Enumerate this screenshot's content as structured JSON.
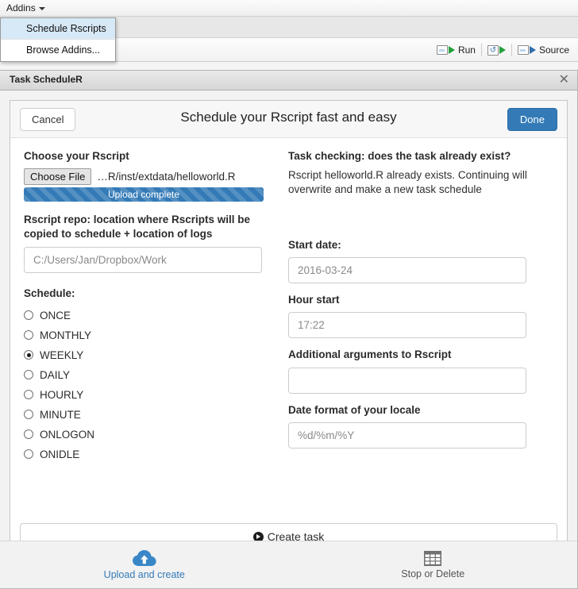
{
  "ide": {
    "menu_label": "Addins",
    "toolbar": [
      {
        "label": "Run",
        "icon": "run-icon"
      },
      {
        "label": "",
        "icon": "rerun-icon"
      },
      {
        "label": "Source",
        "icon": "source-icon"
      }
    ],
    "addins_menu": {
      "items": [
        {
          "label": "Schedule Rscripts",
          "active": true
        },
        {
          "label": "Browse Addins...",
          "active": false
        }
      ]
    }
  },
  "gadget": {
    "window_title": "Task ScheduleR",
    "close_icon": "close-icon",
    "header": {
      "cancel_label": "Cancel",
      "title": "Schedule your Rscript fast and easy",
      "done_label": "Done"
    },
    "left": {
      "choose_label": "Choose your Rscript",
      "file_button": "Choose File",
      "file_name": "…R/inst/extdata/helloworld.R",
      "progress_label": "Upload complete",
      "progress_percent": 100,
      "repo_label": "Rscript repo: location where Rscripts will be copied to schedule + location of logs",
      "repo_value": "C:/Users/Jan/Dropbox/Work",
      "schedule_label": "Schedule:",
      "schedule_options": [
        {
          "label": "ONCE",
          "selected": false
        },
        {
          "label": "MONTHLY",
          "selected": false
        },
        {
          "label": "WEEKLY",
          "selected": true
        },
        {
          "label": "DAILY",
          "selected": false
        },
        {
          "label": "HOURLY",
          "selected": false
        },
        {
          "label": "MINUTE",
          "selected": false
        },
        {
          "label": "ONLOGON",
          "selected": false
        },
        {
          "label": "ONIDLE",
          "selected": false
        }
      ]
    },
    "right": {
      "check_title": "Task checking: does the task already exist?",
      "check_text": "Rscript helloworld.R already exists. Continuing will overwrite and make a new task schedule",
      "start_date_label": "Start date:",
      "start_date_value": "2016-03-24",
      "hour_label": "Hour start",
      "hour_value": "17:22",
      "args_label": "Additional arguments to Rscript",
      "args_value": "",
      "dateformat_label": "Date format of your locale",
      "dateformat_value": "%d/%m/%Y"
    },
    "create_button": "Create task",
    "tabs": [
      {
        "label": "Upload and create",
        "icon": "cloud-upload-icon",
        "active": true
      },
      {
        "label": "Stop or Delete",
        "icon": "table-grid-icon",
        "active": false
      }
    ]
  },
  "colors": {
    "primary": "#337ab7",
    "tab_active": "#337ab7",
    "tab_idle": "#555555",
    "menu_highlight": "#d7e9f7"
  }
}
